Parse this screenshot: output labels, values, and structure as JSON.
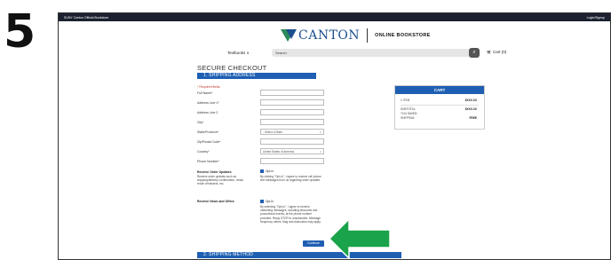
{
  "step_number": "5",
  "top_bar": {
    "left": "SUNY Canton Official Bookstore",
    "right": "Login/Signup"
  },
  "logo": {
    "brand": "CANTON",
    "tagline": "STATE UNIVERSITY OF NEW YORK",
    "right_text": "ONLINE BOOKSTORE"
  },
  "nav": {
    "textbooks": "Textbooks ∨",
    "search_placeholder": "Search",
    "search_icon": "magnifier-icon",
    "cart_label": "Cart (0)"
  },
  "page_title": "SECURE CHECKOUT",
  "shipping_address": {
    "section_title": "1. SHIPPING ADDRESS",
    "required_note": "* Required fields",
    "fields": [
      {
        "label": "Full Name*"
      },
      {
        "label": "Address Line 1*"
      },
      {
        "label": "Address Line 2"
      },
      {
        "label": "City*"
      },
      {
        "label": "State/Province*",
        "value": "- Select a State -"
      },
      {
        "label": "Zip/Postal Code*"
      },
      {
        "label": "Country*",
        "value": "United States of America"
      },
      {
        "label": "Phone Number*"
      }
    ]
  },
  "order_updates": {
    "title": "Receive Order Updates",
    "description": "Receive order updates such as shipping/delivery confirmation, rental return reminders, etc.",
    "opt_in_label": "Opt-In",
    "opt_in_text": "By clicking \"Opt-in\", I agree to receive cell phone text messages from us regarding order updates."
  },
  "news_offers": {
    "title": "Receive News and Offers",
    "opt_in_label": "Opt-In",
    "opt_in_text": "By selecting \"Opt-In\", I agree to receive marketing messages, including discounts and promotional events, at the phone number provided. Reply STOP to unsubscribe. Message frequency varies. Msg and data rates may apply."
  },
  "continue_label": "Continue",
  "shipping_method": {
    "section_title": "2. SHIPPING METHOD"
  },
  "cart": {
    "title": "CART",
    "rows": [
      {
        "label": "1 ITEM",
        "value": "$XXX.XX"
      },
      {
        "label": "SUBTOTAL:",
        "value": "$XXX.XX"
      },
      {
        "label": "YOU SAVED:",
        "value": ""
      },
      {
        "label": "SHIPPING:",
        "value": "FREE"
      }
    ]
  },
  "colors": {
    "accent_blue": "#1f5fb3",
    "arrow_green": "#1aa34a"
  }
}
